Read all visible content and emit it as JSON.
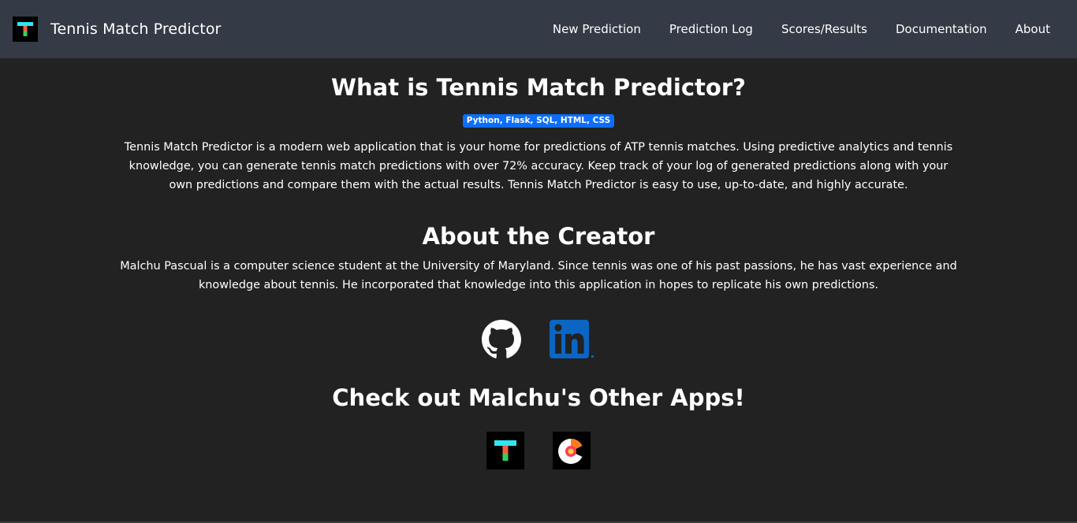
{
  "navbar": {
    "brand_title": "Tennis Match Predictor",
    "links": [
      {
        "label": "New Prediction"
      },
      {
        "label": "Prediction Log"
      },
      {
        "label": "Scores/Results"
      },
      {
        "label": "Documentation"
      },
      {
        "label": "About"
      }
    ]
  },
  "about_app": {
    "title": "What is Tennis Match Predictor?",
    "tech_badge": "Python, Flask, SQL, HTML, CSS",
    "description": "Tennis Match Predictor is a modern web application that is your home for predictions of ATP tennis matches. Using predictive analytics and tennis knowledge, you can generate tennis match predictions with over 72% accuracy. Keep track of your log of generated predictions along with your own predictions and compare them with the actual results. Tennis Match Predictor is easy to use, up-to-date, and highly accurate."
  },
  "about_creator": {
    "title": "About the Creator",
    "description": "Malchu Pascual is a computer science student at the University of Maryland. Since tennis was one of his past passions, he has vast experience and knowledge about tennis. He incorporated that knowledge into this application in hopes to replicate his own predictions."
  },
  "social": {
    "icons": [
      "github-icon",
      "linkedin-icon"
    ],
    "linkedin_color": "#0a66c2"
  },
  "other_apps": {
    "title": "Check out Malchu's Other Apps!",
    "icons": [
      "tennis-match-predictor-app-icon",
      "colorful-c-app-icon"
    ]
  },
  "colors": {
    "navbar_bg": "#343a46",
    "page_bg": "#222222",
    "badge_bg": "#0d6efd",
    "logo_cyan": "#2ee6f0",
    "logo_orange": "#ff5a3c",
    "logo_green": "#34d058"
  }
}
